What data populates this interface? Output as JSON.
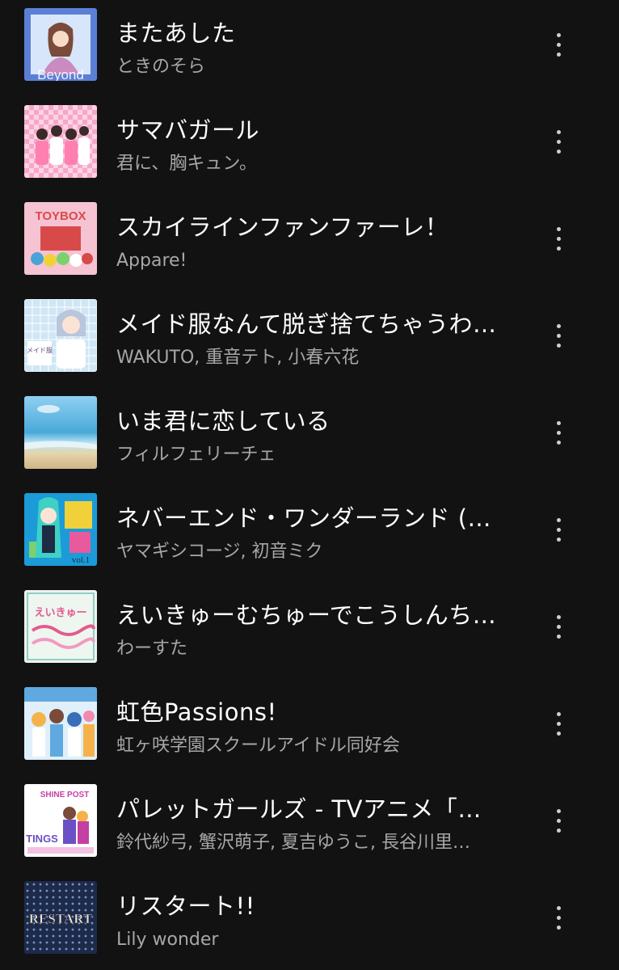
{
  "tracks": [
    {
      "title": "またあした",
      "artist": "ときのそら",
      "art": "beyond-album-art",
      "colors": [
        "#5c7fd6",
        "#e8b5d8"
      ]
    },
    {
      "title": "サマバガール",
      "artist": "君に、胸キュン。",
      "art": "pink-group-album-art",
      "colors": [
        "#f7a6c8",
        "#ffffff"
      ]
    },
    {
      "title": "スカイラインファンファーレ！",
      "artist": "Appare!",
      "art": "toybox-album-art",
      "colors": [
        "#f6c3d3",
        "#d84a4a"
      ]
    },
    {
      "title": "メイド服なんて脱ぎ捨てちゃうわ…",
      "artist": "WAKUTO, 重音テト, 小春六花",
      "art": "maid-album-art",
      "colors": [
        "#cfe6f5",
        "#ffffff"
      ]
    },
    {
      "title": "いま君に恋している",
      "artist": "フィルフェリーチェ",
      "art": "beach-album-art",
      "colors": [
        "#7fc7ea",
        "#e6d3a8"
      ]
    },
    {
      "title": "ネバーエンド・ワンダーランド (fe…",
      "artist": "ヤマギシコージ, 初音ミク",
      "art": "miku-album-art",
      "colors": [
        "#1b9bd8",
        "#f0d13a"
      ]
    },
    {
      "title": "えいきゅーむちゅーでこうしんち…",
      "artist": "わーすた",
      "art": "wasuta-album-art",
      "colors": [
        "#f1f1ec",
        "#e45a8f"
      ]
    },
    {
      "title": "虹色Passions!",
      "artist": "虹ヶ咲学園スクールアイドル同好会",
      "art": "nijigasaki-album-art",
      "colors": [
        "#5fa9e0",
        "#f5b24a"
      ]
    },
    {
      "title": "パレットガールズ - TVアニメ「シ…",
      "artist": "鈴代紗弓, 蟹沢萌子, 夏吉ゆうこ, 長谷川里…",
      "art": "shine-post-album-art",
      "colors": [
        "#ffffff",
        "#c43fa5"
      ]
    },
    {
      "title": "リスタート!!",
      "artist": "Lily wonder",
      "art": "restart-album-art",
      "colors": [
        "#1d2a4a",
        "#f2e9c9"
      ]
    }
  ],
  "cover_text": {
    "beyond": "Beyond",
    "toybox": "TOYBOX",
    "maid": "メイド服",
    "wasuta": "えいきゅー",
    "vol": "vol.1",
    "shine_post": "SHINE POST",
    "tings": "TINGS",
    "restart": "RESTART"
  }
}
